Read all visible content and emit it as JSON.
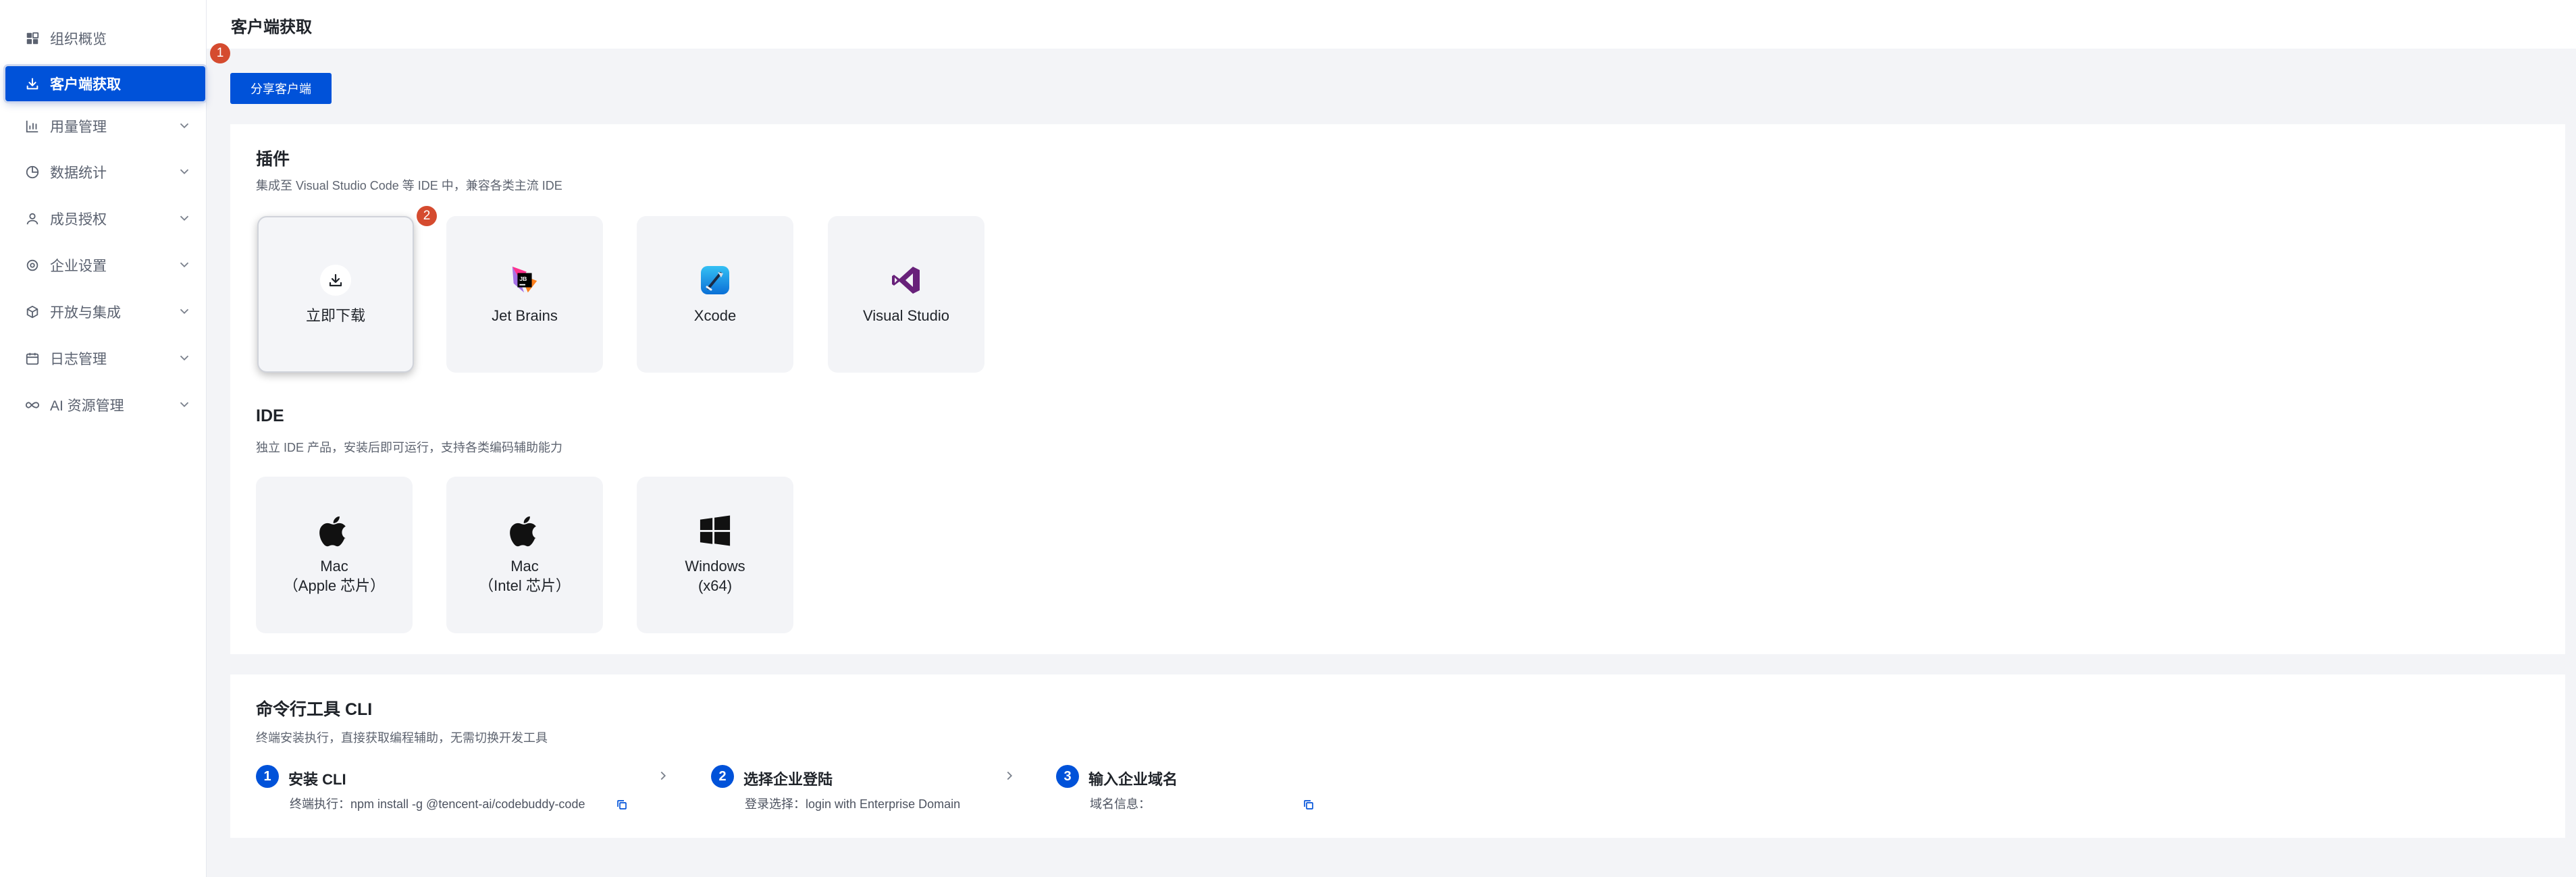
{
  "sidebar": {
    "items": [
      {
        "label": "组织概览",
        "icon": "grid-icon"
      },
      {
        "label": "客户端获取",
        "icon": "download-icon",
        "active": true
      },
      {
        "label": "用量管理",
        "icon": "bar-chart-icon"
      },
      {
        "label": "数据统计",
        "icon": "pie-chart-icon"
      },
      {
        "label": "成员授权",
        "icon": "user-icon"
      },
      {
        "label": "企业设置",
        "icon": "gear-icon"
      },
      {
        "label": "开放与集成",
        "icon": "cube-icon"
      },
      {
        "label": "日志管理",
        "icon": "calendar-log-icon"
      },
      {
        "label": "AI 资源管理",
        "icon": "infinity-icon"
      }
    ]
  },
  "badges": {
    "step1": "1",
    "step2": "2"
  },
  "header": {
    "title": "客户端获取"
  },
  "share_button": "分享客户端",
  "plugins": {
    "title": "插件",
    "desc": "集成至 Visual Studio Code 等 IDE 中，兼容各类主流 IDE",
    "tiles": [
      {
        "label": "立即下载",
        "icon": "download-icon"
      },
      {
        "label": "Jet Brains",
        "icon": "jetbrains-icon"
      },
      {
        "label": "Xcode",
        "icon": "xcode-icon"
      },
      {
        "label": "Visual Studio",
        "icon": "visual-studio-icon"
      }
    ]
  },
  "ide": {
    "title": "IDE",
    "desc": "独立 IDE 产品，安装后即可运行，支持各类编码辅助能力",
    "tiles": [
      {
        "line1": "Mac",
        "line2": "（Apple 芯片）",
        "icon": "apple-icon"
      },
      {
        "line1": "Mac",
        "line2": "（Intel 芯片）",
        "icon": "apple-icon"
      },
      {
        "line1": "Windows",
        "line2": "(x64)",
        "icon": "windows-icon"
      }
    ]
  },
  "cli": {
    "title": "命令行工具 CLI",
    "desc": "终端安装执行，直接获取编程辅助，无需切换开发工具",
    "steps": [
      {
        "num": "1",
        "title": "安装 CLI",
        "desc": "终端执行：npm install -g @tencent-ai/codebuddy-code"
      },
      {
        "num": "2",
        "title": "选择企业登陆",
        "desc": "登录选择：login with Enterprise Domain"
      },
      {
        "num": "3",
        "title": "输入企业域名",
        "desc": "域名信息："
      }
    ]
  },
  "colors": {
    "accent": "#0052d9",
    "badge": "#d54b2f",
    "background": "#f3f4f7"
  }
}
